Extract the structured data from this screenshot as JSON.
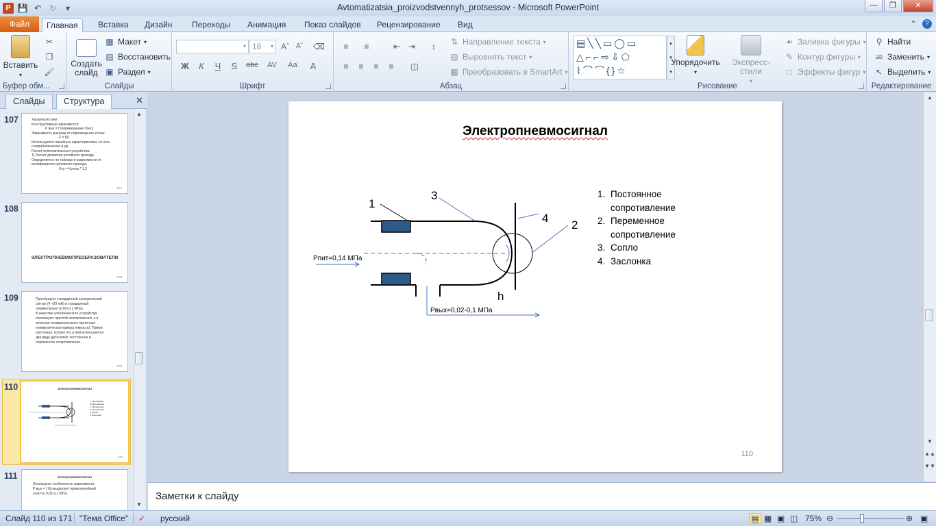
{
  "window": {
    "title": "Avtomatizatsia_proizvodstvennyh_protsessov  -  Microsoft PowerPoint"
  },
  "ribbon_tabs": [
    "Файл",
    "Главная",
    "Вставка",
    "Дизайн",
    "Переходы",
    "Анимация",
    "Показ слайдов",
    "Рецензирование",
    "Вид"
  ],
  "ribbon": {
    "clipboard": {
      "paste": "Вставить",
      "label": "Буфер обм..."
    },
    "slides": {
      "new_slide": "Создать слайд",
      "layout": "Макет",
      "reset": "Восстановить",
      "section": "Раздел",
      "label": "Слайды"
    },
    "font": {
      "size": "18",
      "label": "Шрифт",
      "bold": "Ж",
      "italic": "К",
      "underline": "Ч",
      "shadow": "S",
      "strike": "abc",
      "spacing": "AV",
      "case": "Aa",
      "color": "A"
    },
    "paragraph": {
      "text_direction": "Направление текста",
      "align_text": "Выровнять текст",
      "smartart": "Преобразовать в SmartArt",
      "label": "Абзац"
    },
    "drawing": {
      "arrange": "Упорядочить",
      "quick_styles": "Экспресс-стили",
      "fill": "Заливка фигуры",
      "outline": "Контур фигуры",
      "effects": "Эффекты фигур",
      "label": "Рисование"
    },
    "editing": {
      "find": "Найти",
      "replace": "Заменить",
      "select": "Выделить",
      "label": "Редактирование"
    }
  },
  "left_panel": {
    "tabs": [
      "Слайды",
      "Структура"
    ],
    "thumbnails": [
      {
        "number": "107",
        "lines": [
          "Характеристики:",
          "Конструктивные зависимости",
          "P вых = f (перемещение тока);",
          "Зависимость расхода от перемещения штока:",
          "F = f(l)",
          "Используются линейные характеристики, но есть",
          "и параболические и др.",
          "Расчет исполнительного устройства:",
          "1) Расчет диаметра условного прохода.",
          "Определяется по таблице в зависимости от",
          "коэффициента условного прохода.",
          "Kvy = Kvmax * 1,2"
        ],
        "page": "107"
      },
      {
        "number": "108",
        "heading": "ЭЛЕКТРОПНЕВМОПРЕОБРАЗОВАТЕЛИ",
        "page": "108"
      },
      {
        "number": "109",
        "lines": [
          "Преобразует стандартный электрический",
          "сигнал (4 ÷20 mA) в стандартный",
          "пневмосигнал (0,02÷0,1 МПа).",
          "В качестве электрического устройства",
          "используют простой электромагнит, а в",
          "качестве пневматического-проточная",
          "пневматическая камера (емкость). Прими",
          "проточная, потому что в ней используются",
          "два вида дросселей: постоянное и",
          "переменное сопротивление."
        ],
        "page": "109"
      },
      {
        "number": "110",
        "heading": "Электропневмосигнал",
        "page": "110"
      },
      {
        "number": "111",
        "heading": "Электропневмосигнал",
        "lines": [
          "Используют особенность зависимости",
          "P вых = f (h)-выделяют прямолинейный",
          "участок 0,02-0,1 МПа."
        ]
      }
    ]
  },
  "slide": {
    "title": "Электропневмосигнал",
    "list": [
      {
        "n": "1.",
        "text": "Постоянное сопротивление"
      },
      {
        "n": "2.",
        "text": "Переменное сопротивление"
      },
      {
        "n": "3.",
        "text": "Сопло"
      },
      {
        "n": "4.",
        "text": "Заслонка"
      }
    ],
    "diagram_labels": {
      "l1": "1",
      "l2": "2",
      "l3": "3",
      "l4": "4",
      "h": "h",
      "pin": "Рпит=0,14 МПа",
      "pout": "Рвых=0,02-0,1 МПа"
    },
    "page_number": "110"
  },
  "notes": {
    "placeholder": "Заметки к слайду"
  },
  "status": {
    "slide_info": "Слайд 110 из 171",
    "theme": "\"Тема Office\"",
    "language": "русский",
    "zoom": "75%"
  },
  "colors": {
    "accent_orange": "#d65e14",
    "ribbon_bg": "#dfe8f4",
    "selected_thumb": "#f0c24a",
    "rect_fill": "#2e5a8c"
  }
}
